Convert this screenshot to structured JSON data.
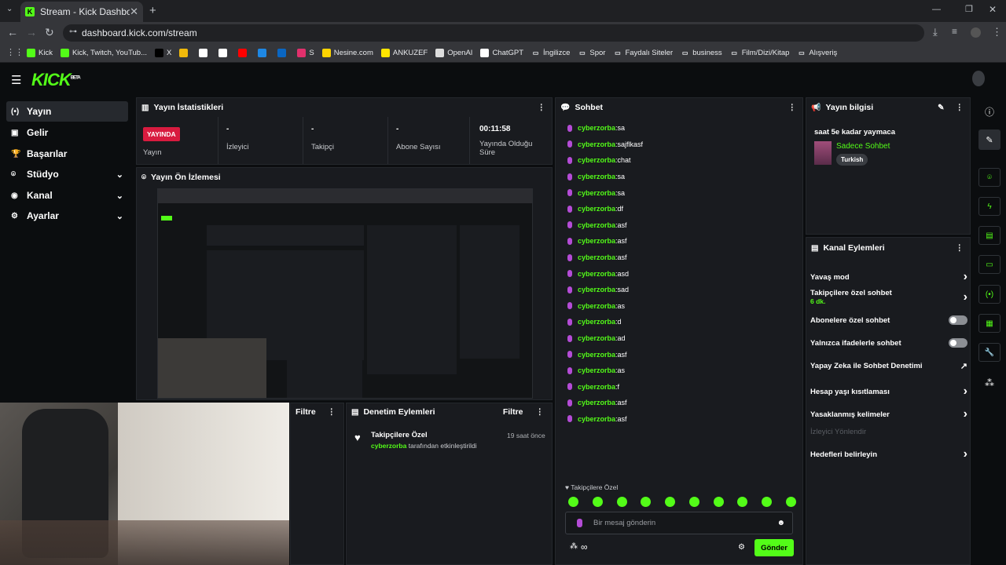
{
  "browser": {
    "tab_title": "Stream - Kick Dashboard",
    "url": "dashboard.kick.com/stream",
    "bookmarks": [
      "Kick",
      "Kick, Twitch, YouTub...",
      "X",
      "",
      "",
      "",
      "",
      "",
      "",
      "S",
      "Nesine.com",
      "ANKUZEF",
      "OpenAI",
      "ChatGPT",
      "İngilizce",
      "Spor",
      "Faydalı Siteler",
      "business",
      "Film/Dizi/Kitap",
      "Alışveriş"
    ]
  },
  "app": {
    "logo": "KICK",
    "logo_badge": "BETA",
    "nav": [
      {
        "label": "Yayın",
        "icon": "(•)"
      },
      {
        "label": "Gelir",
        "icon": "▣"
      },
      {
        "label": "Başarılar",
        "icon": "🏆"
      },
      {
        "label": "Stüdyo",
        "icon": "⌾"
      },
      {
        "label": "Kanal",
        "icon": "◉"
      },
      {
        "label": "Ayarlar",
        "icon": "⚙"
      }
    ]
  },
  "stats": {
    "title": "Yayın İstatistikleri",
    "live_badge": "YAYINDA",
    "live_label": "Yayın",
    "viewers_value": "-",
    "viewers_label": "İzleyici",
    "followers_value": "-",
    "followers_label": "Takipçi",
    "subs_value": "-",
    "subs_label": "Abone Sayısı",
    "duration_value": "00:11:58",
    "duration_label": "Yayında Olduğu Süre"
  },
  "preview": {
    "title": "Yayın Ön İzlemesi"
  },
  "filter_panel": {
    "label": "Filtre"
  },
  "moderation": {
    "title": "Denetim Eylemleri",
    "filter": "Filtre",
    "entry_title": "Takipçilere Özel",
    "entry_time": "19 saat önce",
    "entry_user": "cyberzorba",
    "entry_text": "tarafından etkinleştirildi"
  },
  "chat": {
    "title": "Sohbet",
    "messages": [
      {
        "user": "cyberzorba",
        "text": "sa"
      },
      {
        "user": "cyberzorba",
        "text": "sajflkasf"
      },
      {
        "user": "cyberzorba",
        "text": "chat"
      },
      {
        "user": "cyberzorba",
        "text": "sa"
      },
      {
        "user": "cyberzorba",
        "text": "sa"
      },
      {
        "user": "cyberzorba",
        "text": "df"
      },
      {
        "user": "cyberzorba",
        "text": "asf"
      },
      {
        "user": "cyberzorba",
        "text": "asf"
      },
      {
        "user": "cyberzorba",
        "text": "asf"
      },
      {
        "user": "cyberzorba",
        "text": "asd"
      },
      {
        "user": "cyberzorba",
        "text": "sad"
      },
      {
        "user": "cyberzorba",
        "text": "as"
      },
      {
        "user": "cyberzorba",
        "text": "d"
      },
      {
        "user": "cyberzorba",
        "text": "ad"
      },
      {
        "user": "cyberzorba",
        "text": "asf"
      },
      {
        "user": "cyberzorba",
        "text": "as"
      },
      {
        "user": "cyberzorba",
        "text": "f"
      },
      {
        "user": "cyberzorba",
        "text": "asf"
      },
      {
        "user": "cyberzorba",
        "text": "asf"
      }
    ],
    "mode_label": "Takipçilere Özel",
    "placeholder": "Bir mesaj gönderin",
    "send": "Gönder"
  },
  "stream_info": {
    "title": "Yayın bilgisi",
    "stream_title": "saat 5e kadar yaymaca",
    "category": "Sadece Sohbet",
    "language": "Turkish"
  },
  "channel_actions": {
    "title": "Kanal Eylemleri",
    "items": [
      {
        "label": "Yavaş mod",
        "type": "chevron"
      },
      {
        "label": "Takipçilere özel sohbet",
        "sub": "6 dk.",
        "type": "chevron"
      },
      {
        "label": "Abonelere özel sohbet",
        "type": "toggle"
      },
      {
        "label": "Yalnızca ifadelerle sohbet",
        "type": "toggle"
      },
      {
        "label": "Yapay Zeka ile Sohbet Denetimi",
        "type": "external"
      },
      {
        "label": "Hesap yaşı kısıtlaması",
        "type": "chevron"
      },
      {
        "label": "Yasaklanmış kelimeler",
        "type": "chevron"
      },
      {
        "label": "İzleyici Yönlendir",
        "type": "disabled"
      },
      {
        "label": "Hedefleri belirleyin",
        "type": "chevron"
      }
    ]
  }
}
